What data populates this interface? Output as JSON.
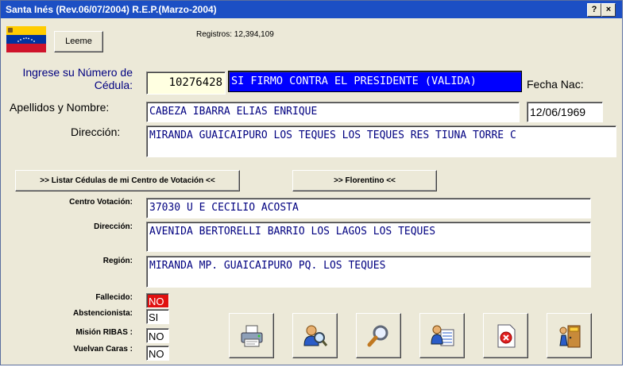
{
  "window": {
    "title": "Santa Inés (Rev.06/07/2004) R.E.P.(Marzo-2004)",
    "help_btn": "?",
    "close_btn": "×"
  },
  "header": {
    "leeme_label": "Leeme",
    "registros": "Registros: 12,394,109"
  },
  "form": {
    "cedula_label": "Ingrese su Número de Cédula:",
    "cedula_value": "10276428",
    "status": "SI FIRMO CONTRA EL PRESIDENTE  (VALIDA)",
    "fecha_label": "Fecha Nac:",
    "fecha_value": "12/06/1969",
    "nombre_label": "Apellidos y Nombre:",
    "nombre_value": "CABEZA IBARRA ELIAS ENRIQUE",
    "direccion_label": "Dirección:",
    "direccion_value": "MIRANDA GUAICAIPURO LOS TEQUES LOS TEQUES RES TIUNA TORRE C"
  },
  "actions": {
    "listar_label": ">> Listar Cédulas de mi Centro de Votación <<",
    "florentino_label": ">> Florentino <<"
  },
  "centro": {
    "centro_label": "Centro Votación:",
    "centro_value": "37030 U E CECILIO ACOSTA",
    "direccion_label": "Dirección:",
    "direccion_value": "AVENIDA BERTORELLI BARRIO LOS LAGOS LOS TEQUES",
    "region_label": "Región:",
    "region_value": "MIRANDA MP. GUAICAIPURO PQ. LOS TEQUES"
  },
  "flags": {
    "fallecido_label": "Fallecido:",
    "fallecido_value": "NO",
    "abstencionista_label": "Abstencionista:",
    "abstencionista_value": "SI",
    "ribas_label": "Misión RIBAS :",
    "ribas_value": "NO",
    "vuelvan_label": "Vuelvan Caras :",
    "vuelvan_value": "NO"
  },
  "colors": {
    "status_bg": "#0000ff",
    "cedula_bg": "#ffffe1",
    "fallecido_bg": "#e01010"
  },
  "toolbar_icons": [
    "printer-icon",
    "user-search-icon",
    "magnifier-icon",
    "user-list-icon",
    "delete-document-icon",
    "exit-door-icon"
  ]
}
